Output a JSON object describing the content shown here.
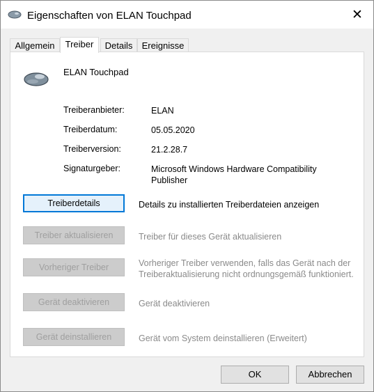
{
  "window": {
    "title": "Eigenschaften von ELAN Touchpad",
    "close_glyph": "✕"
  },
  "tabs": [
    {
      "label": "Allgemein",
      "active": false
    },
    {
      "label": "Treiber",
      "active": true
    },
    {
      "label": "Details",
      "active": false
    },
    {
      "label": "Ereignisse",
      "active": false
    }
  ],
  "device": {
    "name": "ELAN Touchpad",
    "icon": "mouse-icon"
  },
  "properties": [
    {
      "label": "Treiberanbieter:",
      "value": "ELAN"
    },
    {
      "label": "Treiberdatum:",
      "value": "05.05.2020"
    },
    {
      "label": "Treiberversion:",
      "value": "21.2.28.7"
    },
    {
      "label": "Signaturgeber:",
      "value": "Microsoft Windows Hardware Compatibility Publisher"
    }
  ],
  "actions": [
    {
      "button": "Treiberdetails",
      "description": "Details zu installierten Treiberdateien anzeigen",
      "enabled": true
    },
    {
      "button": "Treiber aktualisieren",
      "description": "Treiber für dieses Gerät aktualisieren",
      "enabled": false
    },
    {
      "button": "Vorheriger Treiber",
      "description": "Vorheriger Treiber verwenden, falls das Gerät nach der Treiberaktualisierung nicht ordnungsgemäß funktioniert.",
      "enabled": false
    },
    {
      "button": "Gerät deaktivieren",
      "description": "Gerät deaktivieren",
      "enabled": false
    },
    {
      "button": "Gerät deinstallieren",
      "description": "Gerät vom System deinstallieren (Erweitert)",
      "enabled": false
    }
  ],
  "footer": {
    "ok_label": "OK",
    "cancel_label": "Abbrechen"
  },
  "colors": {
    "accent": "#0078d7",
    "dialog_bg": "#f0f0f0",
    "panel_bg": "#ffffff"
  }
}
